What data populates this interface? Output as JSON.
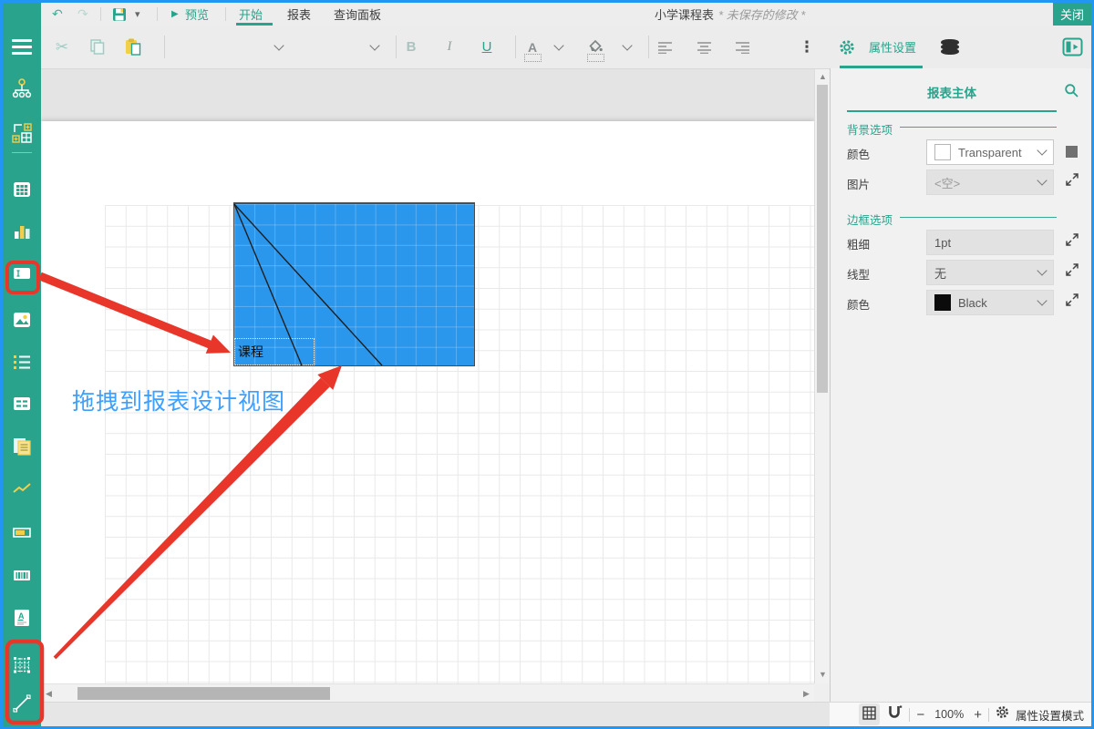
{
  "app": {
    "accent_color": "#2aa38c",
    "window_border_color": "#2196f3"
  },
  "titlebar": {
    "preview": "预览",
    "tab_home": "开始",
    "tab_report": "报表",
    "tab_query": "查询面板",
    "doc_title": "小学课程表",
    "modified_hint": "* 未保存的修改 *",
    "close": "关闭"
  },
  "toolbar": {
    "bold": "B",
    "italic": "I",
    "underline": "U",
    "font_color": "A",
    "properties_tab": "属性设置"
  },
  "glyphs": {
    "undo": "↶",
    "redo": "↷",
    "save_caret": "▾",
    "play": "▶",
    "scissors": "✂",
    "kebab": "⋮",
    "scroll_up": "▲",
    "scroll_down": "▼",
    "scroll_left": "◀",
    "scroll_right": "▶"
  },
  "sidebar": {
    "icons": [
      "menu",
      "hierarchy",
      "matrix",
      "table",
      "chart",
      "textbox",
      "image",
      "list",
      "data-table",
      "subreport",
      "sparkline",
      "data-bar",
      "barcode",
      "rich-text",
      "matrix-grid",
      "line"
    ]
  },
  "canvas": {
    "cell_text": "课程",
    "annotation": "拖拽到报表设计视图",
    "table_fill": "#2b97ec",
    "annotation_text_color": "#3e9fff",
    "highlight_color": "#e8362b"
  },
  "panel": {
    "title": "报表主体",
    "bg_section": "背景选项",
    "color_label": "颜色",
    "color_value": "Transparent",
    "image_label": "图片",
    "image_value": "<空>",
    "border_section": "边框选项",
    "weight_label": "粗细",
    "weight_value": "1pt",
    "style_label": "线型",
    "style_value": "无",
    "border_color_label": "颜色",
    "border_color_value": "Black"
  },
  "statusbar": {
    "minus": "−",
    "zoom": "100%",
    "plus": "+",
    "mode": "属性设置模式"
  }
}
